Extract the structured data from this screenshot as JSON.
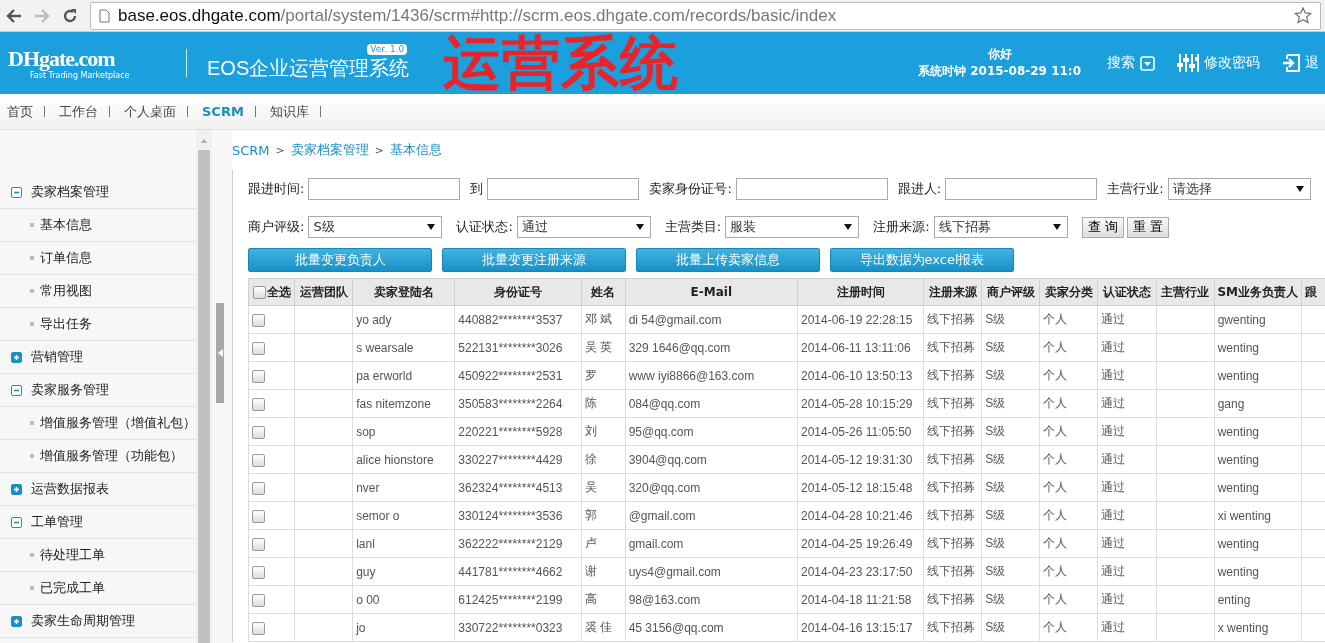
{
  "browser": {
    "url_host": "base.eos.dhgate.com",
    "url_path": "/portal/system/1436/scrm#http://scrm.eos.dhgate.com/records/basic/index",
    "forward_disabled": true
  },
  "header": {
    "logo": "DHgate.com",
    "logo_tagline": "Fast Trading Marketplace",
    "title": "EOS企业运营管理系统",
    "version": "Ver. 1.0",
    "banner": "运营系统",
    "greeting": "你好",
    "clock": "系统时钟 2015-08-29 11:0",
    "actions": [
      {
        "kind": "search",
        "label": "搜索"
      },
      {
        "kind": "password",
        "label": "修改密码"
      },
      {
        "kind": "logout",
        "label": "退"
      }
    ]
  },
  "nav": [
    {
      "label": "首页",
      "selected": false
    },
    {
      "label": "工作台",
      "selected": false
    },
    {
      "label": "个人桌面",
      "selected": false
    },
    {
      "label": "SCRM",
      "selected": true
    },
    {
      "label": "知识库",
      "selected": false
    }
  ],
  "sidebar": {
    "items": [
      {
        "label": "卖家档案管理",
        "expanded": true,
        "children": [
          {
            "label": "基本信息"
          },
          {
            "label": "订单信息"
          },
          {
            "label": "常用视图"
          },
          {
            "label": "导出任务"
          }
        ]
      },
      {
        "label": "营销管理",
        "expanded": false
      },
      {
        "label": "卖家服务管理",
        "expanded": true,
        "children": [
          {
            "label": "增值服务管理（增值礼包）"
          },
          {
            "label": "增值服务管理（功能包）"
          }
        ]
      },
      {
        "label": "运营数据报表",
        "expanded": false
      },
      {
        "label": "工单管理",
        "expanded": true,
        "children": [
          {
            "label": "待处理工单"
          },
          {
            "label": "已完成工单"
          }
        ]
      },
      {
        "label": "卖家生命周期管理",
        "expanded": false
      }
    ]
  },
  "breadcrumb": {
    "separator": ">",
    "items": [
      "SCRM",
      "卖家档案管理",
      "基本信息"
    ]
  },
  "filters": [
    [
      {
        "kind": "text",
        "label": "跟进时间:"
      },
      {
        "kind": "text",
        "label": "到"
      },
      {
        "kind": "text",
        "label": "卖家身份证号:"
      },
      {
        "kind": "text",
        "label": "跟进人:"
      },
      {
        "kind": "select",
        "label": "主营行业:",
        "value": "请选择"
      }
    ],
    [
      {
        "kind": "select",
        "label": "商户评级:",
        "value": "S级"
      },
      {
        "kind": "select",
        "label": "认证状态:",
        "value": "通过"
      },
      {
        "kind": "select",
        "label": "主营类目:",
        "value": "服装"
      },
      {
        "kind": "select",
        "label": "注册来源:",
        "value": "线下招募"
      }
    ]
  ],
  "filter_buttons": [
    "查 询",
    "重 置"
  ],
  "actions": [
    "批量变更负责人",
    "批量变更注册来源",
    "批量上传卖家信息",
    "导出数据为excel报表"
  ],
  "table": {
    "columns": [
      {
        "label": "全选",
        "kind": "select-all",
        "checked": false
      },
      {
        "label": "运营团队"
      },
      {
        "label": "卖家登陆名"
      },
      {
        "label": "身份证号"
      },
      {
        "label": "姓名"
      },
      {
        "label": "E-Mail"
      },
      {
        "label": "注册时间"
      },
      {
        "label": "注册来源"
      },
      {
        "label": "商户评级"
      },
      {
        "label": "卖家分类"
      },
      {
        "label": "认证状态"
      },
      {
        "label": "主营行业"
      },
      {
        "label": "SM业务负责人"
      },
      {
        "label": "跟"
      }
    ],
    "rows": [
      {
        "checked": false,
        "login": "yo ady",
        "id_number": "440882********3537",
        "name": "邓 斌",
        "email": "di 54@gmail.com",
        "registered": "2014-06-19 22:28:15",
        "source": "线下招募",
        "rating": "S级",
        "category": "个人",
        "status": "通过",
        "manager": "gwenting"
      },
      {
        "checked": false,
        "login": "s wearsale",
        "id_number": "522131********3026",
        "name": "吴 英",
        "email": "329 1646@qq.com",
        "registered": "2014-06-11 13:11:06",
        "source": "线下招募",
        "rating": "S级",
        "category": "个人",
        "status": "通过",
        "manager": "wenting"
      },
      {
        "checked": false,
        "login": "pa erworld",
        "id_number": "450922********2531",
        "name": "罗",
        "email": "www iyi8866@163.com",
        "registered": "2014-06-10 13:50:13",
        "source": "线下招募",
        "rating": "S级",
        "category": "个人",
        "status": "通过",
        "manager": "wenting"
      },
      {
        "checked": false,
        "login": "fas nitemzone",
        "id_number": "350583********2264",
        "name": "陈",
        "email": "084@qq.com",
        "registered": "2014-05-28 10:15:29",
        "source": "线下招募",
        "rating": "S级",
        "category": "个人",
        "status": "通过",
        "manager": "gang"
      },
      {
        "checked": false,
        "login": "sop",
        "id_number": "220221********5928",
        "name": "刘",
        "email": "95@qq.com",
        "registered": "2014-05-26 11:05:50",
        "source": "线下招募",
        "rating": "S级",
        "category": "个人",
        "status": "通过",
        "manager": "wenting"
      },
      {
        "checked": false,
        "login": "alice hionstore",
        "id_number": "330227********4429",
        "name": "徐",
        "email": "3904@qq.com",
        "registered": "2014-05-12 19:31:30",
        "source": "线下招募",
        "rating": "S级",
        "category": "个人",
        "status": "通过",
        "manager": "wenting"
      },
      {
        "checked": false,
        "login": "nver",
        "id_number": "362324********4513",
        "name": "吴",
        "email": "320@qq.com",
        "registered": "2014-05-12 18:15:48",
        "source": "线下招募",
        "rating": "S级",
        "category": "个人",
        "status": "通过",
        "manager": "wenting"
      },
      {
        "checked": false,
        "login": "semor o",
        "id_number": "330124********3536",
        "name": "郭",
        "email": "@gmail.com",
        "registered": "2014-04-28 10:21:46",
        "source": "线下招募",
        "rating": "S级",
        "category": "个人",
        "status": "通过",
        "manager": "xi wenting"
      },
      {
        "checked": false,
        "login": "lanl",
        "id_number": "362222********2129",
        "name": "卢",
        "email": "gmail.com",
        "registered": "2014-04-25 19:26:49",
        "source": "线下招募",
        "rating": "S级",
        "category": "个人",
        "status": "通过",
        "manager": "wenting"
      },
      {
        "checked": false,
        "login": "guy",
        "id_number": "441781********4662",
        "name": "谢",
        "email": "uys4@gmail.com",
        "registered": "2014-04-23 23:17:50",
        "source": "线下招募",
        "rating": "S级",
        "category": "个人",
        "status": "通过",
        "manager": "wenting"
      },
      {
        "checked": false,
        "login": "o 00",
        "id_number": "612425********2199",
        "name": "高",
        "email": "98@163.com",
        "registered": "2014-04-18 11:21:58",
        "source": "线下招募",
        "rating": "S级",
        "category": "个人",
        "status": "通过",
        "manager": "enting"
      },
      {
        "checked": false,
        "login": "jo",
        "id_number": "330722********0323",
        "name": "裘 佳",
        "email": "45 3156@qq.com",
        "registered": "2014-04-16 13:15:17",
        "source": "线下招募",
        "rating": "S级",
        "category": "个人",
        "status": "通过",
        "manager": "x wenting"
      }
    ]
  }
}
